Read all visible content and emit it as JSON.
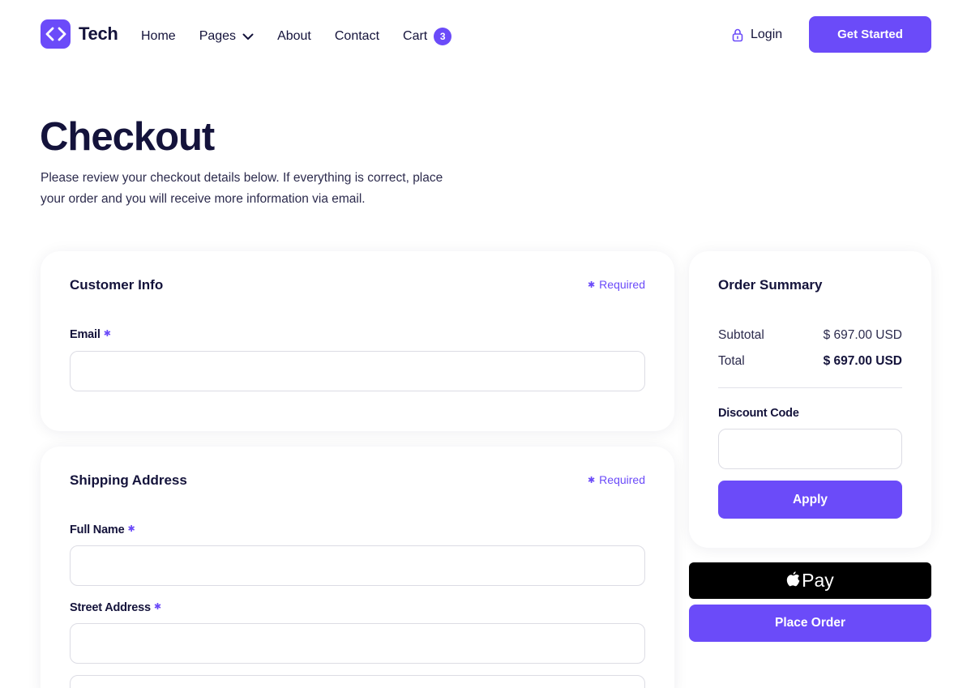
{
  "brand": {
    "name": "Tech",
    "logo_icon": "code-brackets-icon",
    "accent": "#6b4bf9"
  },
  "nav": {
    "items": [
      {
        "label": "Home"
      },
      {
        "label": "Pages"
      },
      {
        "label": "About"
      },
      {
        "label": "Contact"
      },
      {
        "label": "Cart"
      }
    ],
    "cart_count": "3",
    "login_label": "Login",
    "cta_label": "Get Started"
  },
  "page": {
    "title": "Checkout",
    "description": "Please review your checkout details below. If everything is correct, place your order and you will receive more information via email."
  },
  "customer_info": {
    "title": "Customer Info",
    "required_label": "Required",
    "email_label": "Email",
    "email_value": ""
  },
  "shipping": {
    "title": "Shipping Address",
    "required_label": "Required",
    "full_name_label": "Full Name",
    "street_label": "Street Address",
    "full_name_value": "",
    "street_value": "",
    "street2_value": ""
  },
  "summary": {
    "title": "Order Summary",
    "subtotal_label": "Subtotal",
    "subtotal_value": "$ 697.00 USD",
    "total_label": "Total",
    "total_value": "$ 697.00 USD",
    "discount_label": "Discount Code",
    "discount_value": "",
    "apply_label": "Apply"
  },
  "payment": {
    "apple_pay_label": "Pay",
    "place_order_label": "Place Order"
  }
}
